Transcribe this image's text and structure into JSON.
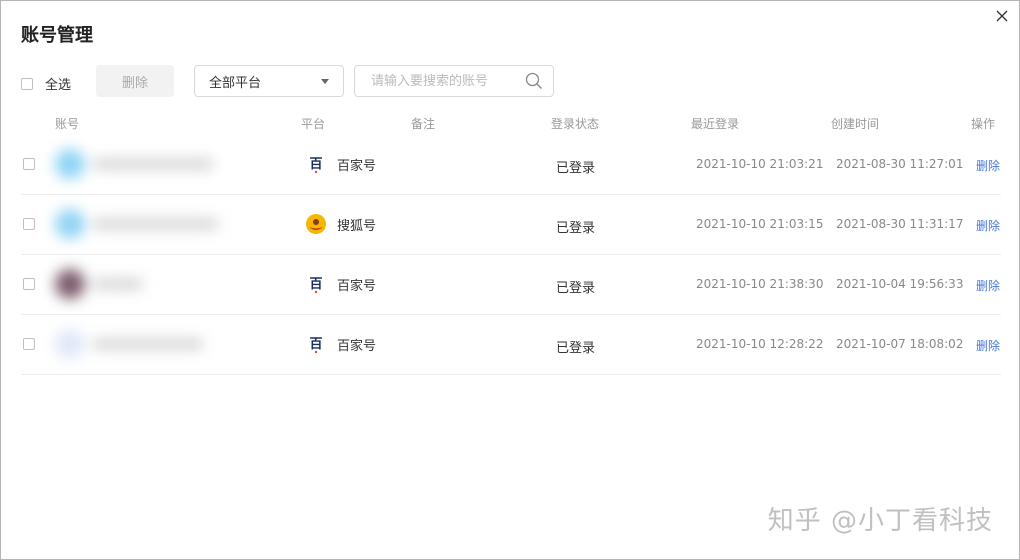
{
  "dialog": {
    "title": "账号管理"
  },
  "toolbar": {
    "select_all_label": "全选",
    "delete_label": "删除",
    "platform_value": "全部平台",
    "search_placeholder": "请输入要搜索的账号"
  },
  "table": {
    "headers": {
      "account": "账号",
      "platform": "平台",
      "note": "备注",
      "status": "登录状态",
      "last_login": "最近登录",
      "created": "创建时间",
      "action": "操作"
    },
    "rows": [
      {
        "platform": "百家号",
        "platform_icon": "baijiahao-icon",
        "note": "",
        "status": "已登录",
        "last_login": "2021-10-10 21:03:21",
        "created": "2021-08-30 11:27:01",
        "action": "删除"
      },
      {
        "platform": "搜狐号",
        "platform_icon": "sohu-icon",
        "note": "",
        "status": "已登录",
        "last_login": "2021-10-10 21:03:15",
        "created": "2021-08-30 11:31:17",
        "action": "删除"
      },
      {
        "platform": "百家号",
        "platform_icon": "baijiahao-icon",
        "note": "",
        "status": "已登录",
        "last_login": "2021-10-10 21:38:30",
        "created": "2021-10-04 19:56:33",
        "action": "删除"
      },
      {
        "platform": "百家号",
        "platform_icon": "baijiahao-icon",
        "note": "",
        "status": "已登录",
        "last_login": "2021-10-10 12:28:22",
        "created": "2021-10-07 18:08:02",
        "action": "删除"
      }
    ]
  },
  "watermark": "知乎 @小丁看科技",
  "colors": {
    "link": "#4a78d8",
    "muted": "#999999",
    "sohu_brand": "#f5b800"
  }
}
